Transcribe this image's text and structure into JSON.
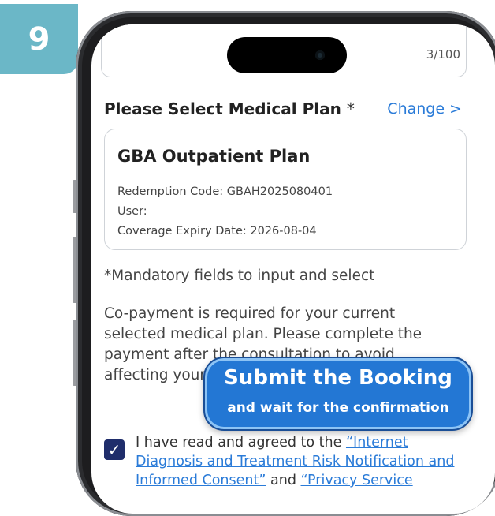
{
  "step": {
    "number": "9"
  },
  "top_card": {
    "counter": "3/100"
  },
  "medical_plan": {
    "title": "Please Select Medical Plan",
    "required_mark": "*",
    "change_label": "Change >",
    "plan": {
      "name": "GBA Outpatient Plan",
      "redemption_code": "Redemption Code: GBAH2025080401",
      "user": "User:",
      "coverage_expiry": "Coverage Expiry Date: 2026-08-04"
    }
  },
  "notes": {
    "mandatory": "*Mandatory fields to input and select",
    "copayment": "Co-payment is required for your current selected medical plan. Please complete the payment after the consultation to avoid affecting your next consultation."
  },
  "agreement": {
    "checked": true,
    "prefix": "I have read and agreed to the",
    "link1": "“Internet Diagnosis and Treatment Risk Notification and Informed Consent”",
    "connector": "and",
    "link2": "“Privacy Service"
  },
  "callout": {
    "title": "Submit the Booking",
    "subtitle": "and wait for the confirmation"
  },
  "colors": {
    "badge": "#6bb7c7",
    "link": "#2a7bd8",
    "callout": "#2377d4",
    "checkbox": "#1f2d6b"
  }
}
